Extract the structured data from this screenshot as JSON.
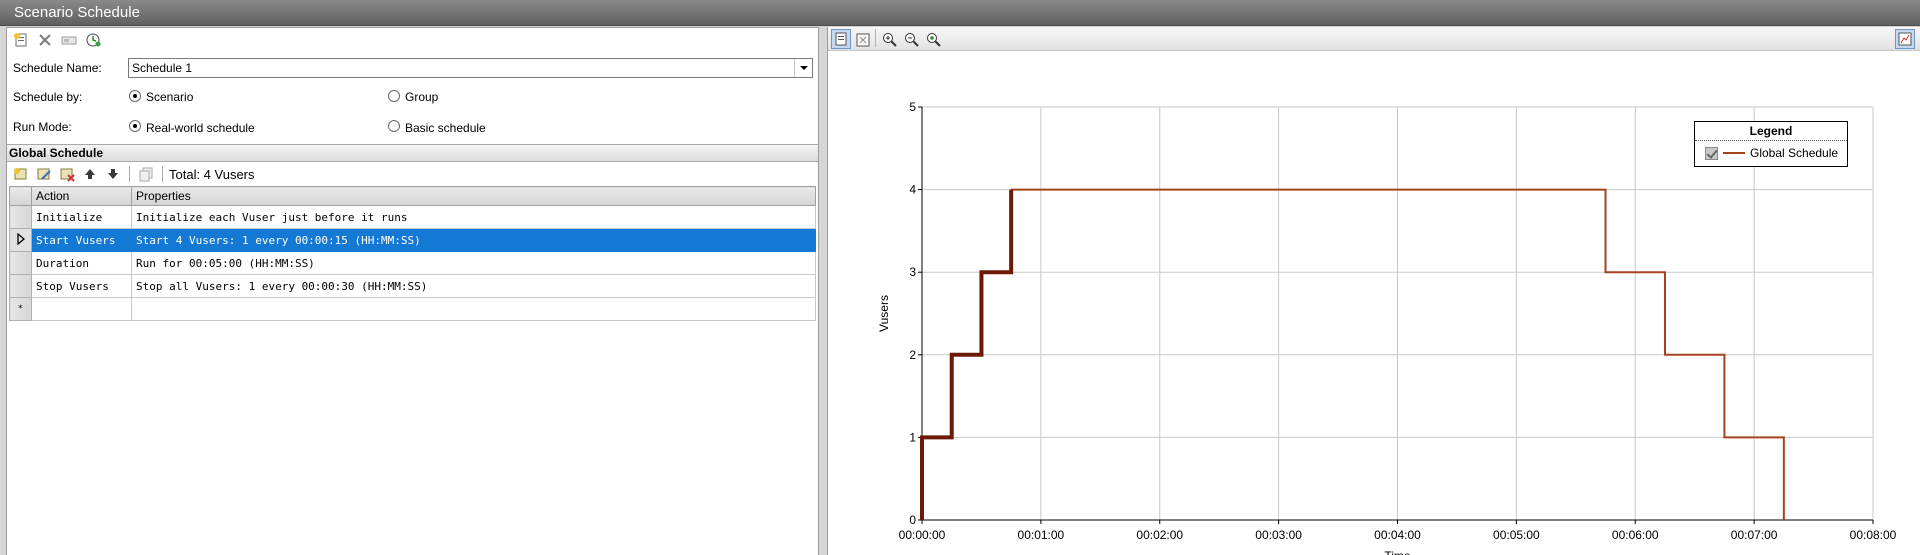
{
  "window": {
    "title": "Scenario Schedule"
  },
  "schedule_form": {
    "name_label": "Schedule Name:",
    "name_value": "Schedule 1",
    "by_label": "Schedule by:",
    "by_options": [
      {
        "label": "Scenario",
        "checked": true
      },
      {
        "label": "Group",
        "checked": false
      }
    ],
    "mode_label": "Run Mode:",
    "mode_options": [
      {
        "label": "Real-world schedule",
        "checked": true
      },
      {
        "label": "Basic schedule",
        "checked": false
      }
    ]
  },
  "global_schedule": {
    "header": "Global Schedule",
    "total": "Total: 4 Vusers",
    "columns": [
      "Action",
      "Properties"
    ],
    "rows": [
      {
        "action": "Initialize",
        "properties": "Initialize each Vuser just before it runs"
      },
      {
        "action": "Start  Vusers",
        "properties": "Start 4 Vusers: 1 every 00:00:15 (HH:MM:SS)"
      },
      {
        "action": "Duration",
        "properties": "Run for 00:05:00 (HH:MM:SS)"
      },
      {
        "action": "Stop Vusers",
        "properties": "Stop all Vusers: 1 every 00:00:30 (HH:MM:SS)"
      }
    ],
    "new_row_marker": "*"
  },
  "legend": {
    "title": "Legend",
    "item": "Global Schedule"
  },
  "colors": {
    "selection": "#1479d4",
    "line_dark": "#6b1a08",
    "line_light": "#a5431c"
  },
  "chart_data": {
    "type": "line",
    "xlabel": "Time",
    "ylabel": "Vusers",
    "xlim": [
      0,
      480
    ],
    "ylim": [
      0,
      5
    ],
    "x_ticks": [
      "00:00:00",
      "00:01:00",
      "00:02:00",
      "00:03:00",
      "00:04:00",
      "00:05:00",
      "00:06:00",
      "00:07:00",
      "00:08:00"
    ],
    "y_ticks": [
      "0",
      "1",
      "2",
      "3",
      "4",
      "5"
    ],
    "grid": true,
    "legend_position": "top-right",
    "series": [
      {
        "name": "Global Schedule",
        "x_seconds": [
          0,
          0,
          15,
          15,
          30,
          30,
          45,
          45,
          345,
          345,
          375,
          375,
          405,
          405,
          435,
          435
        ],
        "y": [
          0,
          1,
          1,
          2,
          2,
          3,
          3,
          4,
          4,
          3,
          3,
          2,
          2,
          1,
          1,
          0
        ]
      }
    ]
  }
}
